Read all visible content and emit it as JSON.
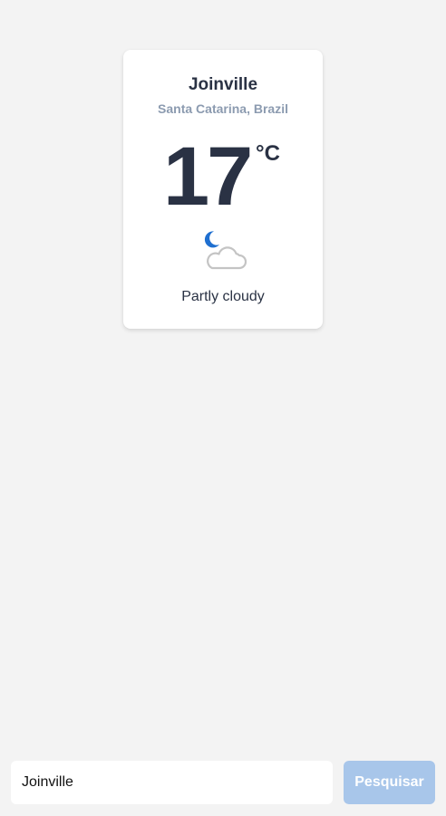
{
  "weather_card": {
    "city": "Joinville",
    "region": "Santa Catarina, Brazil",
    "temperature": "17",
    "unit": "°C",
    "condition": "Partly cloudy",
    "icon": "partly-cloudy-night-icon"
  },
  "search": {
    "value": "Joinville",
    "button_label": "Pesquisar"
  },
  "colors": {
    "background": "#f3f3f3",
    "text_primary": "#2a3244",
    "text_secondary": "#8c9bb0",
    "moon": "#1f6fd0",
    "button": "#a8c6ea"
  }
}
